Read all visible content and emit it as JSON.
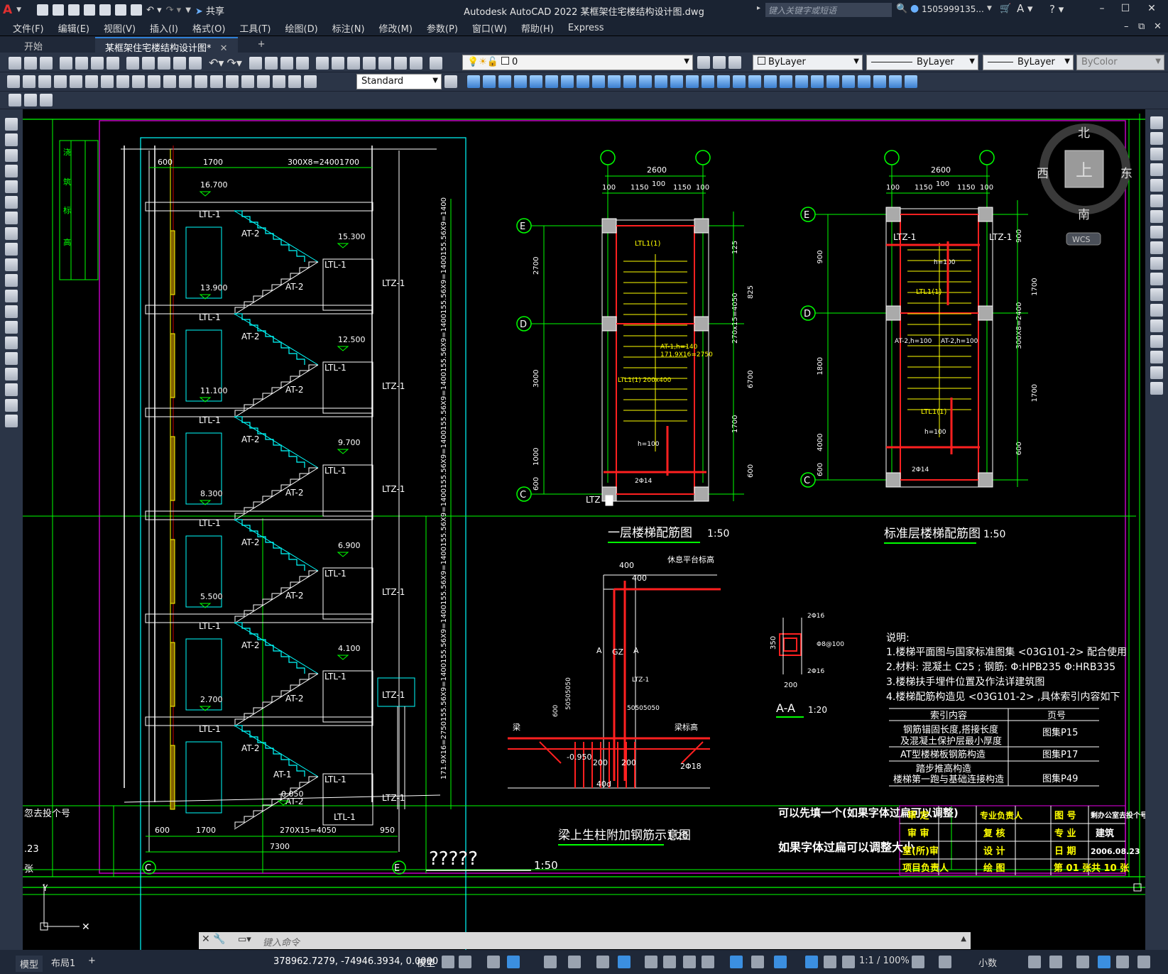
{
  "window": {
    "title": "Autodesk AutoCAD 2022   某框架住宅楼结构设计图.dwg",
    "share": "共享",
    "search_placeholder": "键入关键字或短语",
    "user": "1505999135...",
    "min": "–",
    "max": "☐",
    "close": "✕"
  },
  "menu": [
    "文件(F)",
    "编辑(E)",
    "视图(V)",
    "插入(I)",
    "格式(O)",
    "工具(T)",
    "绘图(D)",
    "标注(N)",
    "修改(M)",
    "参数(P)",
    "窗口(W)",
    "帮助(H)",
    "Express"
  ],
  "tabs": {
    "start": "开始",
    "doc": "某框架住宅楼结构设计图*",
    "close": "✕",
    "add": "+"
  },
  "toolbar": {
    "layer": "0",
    "dimstyle": "Standard",
    "color": "ByLayer",
    "linetype": "ByLayer",
    "lineweight": "ByLayer",
    "plotstyle": "ByColor"
  },
  "viewcube": {
    "north": "北",
    "south": "南",
    "east": "东",
    "west": "西",
    "top": "上",
    "wcs": "WCS"
  },
  "command": {
    "placeholder": "键入命令"
  },
  "status": {
    "model_tab": "模型",
    "layout_tab": "布局1",
    "add": "+",
    "coords": "378962.7279, -74946.3934, 0.0000",
    "model": "模型",
    "scale": "1:1 / 100%",
    "units": "小数"
  },
  "drawing": {
    "section": {
      "top_dims": [
        "600",
        "1700",
        "300X8=2400",
        "1700"
      ],
      "bottom_dims": [
        "600",
        "1700",
        "270X15=4050",
        "950"
      ],
      "total": "7300",
      "elevations": [
        "16.700",
        "15.300",
        "13.900",
        "12.500",
        "11.100",
        "9.700",
        "8.300",
        "6.900",
        "5.500",
        "4.100",
        "2.700",
        "-0.050"
      ],
      "side_dims": [
        "155.56X9=1400",
        "155.56X9=1400",
        "155.56X9=1400",
        "155.56X9=1400",
        "155.56X9=1400",
        "155.56X9=1400",
        "155.56X9=1400",
        "155.56X9=1400",
        "155.56X9=1400",
        "171.9X16=2750"
      ],
      "labels": {
        "ltl1": "LTL-1",
        "at2": "AT-2",
        "at1": "AT-1",
        "ltz1": "LTZ-1"
      },
      "axes": {
        "c": "C",
        "e": "E"
      },
      "title": "?????",
      "scale": "1:50",
      "left_labels": [
        "浇",
        "筑",
        "标",
        "高"
      ]
    },
    "plan1": {
      "title": "一层楼梯配筋图",
      "scale": "1:50",
      "dims_top": [
        "2600",
        "100",
        "1150",
        "100",
        "1150",
        "100"
      ],
      "dims_left": [
        "2700",
        "3000",
        "1000",
        "600"
      ],
      "dims_right": [
        "125",
        "825",
        "270x15=4050",
        "6700",
        "1700",
        "600"
      ],
      "axes": [
        "E",
        "D",
        "C"
      ],
      "ltz": "LTZ",
      "notes": [
        "LTL1(1)",
        "AT-1,h=140",
        "171.9X16=2750",
        "LTL1(1) 200x400",
        "h=100",
        "2Φ14"
      ]
    },
    "plan2": {
      "title": "标准层楼梯配筋图",
      "scale": "1:50",
      "dims_top": [
        "2600",
        "100",
        "1150",
        "100",
        "1150",
        "100"
      ],
      "dims_left": [
        "900",
        "1800",
        "4000",
        "600"
      ],
      "dims_right": [
        "900",
        "1700",
        "300X8=2400",
        "1700",
        "600"
      ],
      "axes": [
        "E",
        "D",
        "C"
      ],
      "labels": [
        "LTZ-1",
        "LTZ-1",
        "LTL1(1)",
        "LTL1(1)",
        "AT-2,h=100",
        "AT-2,h=100",
        "h=100",
        "h=100",
        "2Φ14"
      ]
    },
    "detail": {
      "title": "梁上生柱附加钢筋示意图",
      "scale": "1:20",
      "labels": [
        "休息平台标高",
        "400",
        "400",
        "A",
        "GZ",
        "A",
        "LTZ-1",
        "600",
        "50505050",
        "50505050",
        "梁",
        "梁标高",
        "-0.950",
        "200",
        "200",
        "40d",
        "2Φ18"
      ]
    },
    "aa": {
      "title": "A-A",
      "scale": "1:20",
      "labels": [
        "2Φ16",
        "Φ8@100",
        "350",
        "2Φ16",
        "200"
      ]
    },
    "notes": {
      "heading": "说明:",
      "lines": [
        "1.楼梯平面图与国家标准图集 <03G101-2> 配合使用",
        "2.材料: 混凝土 C25 ; 钢筋: Φ:HPB235  Φ:HRB335",
        "3.楼梯扶手埋件位置及作法详建筑图",
        "4.楼梯配筋构造见 <03G101-2> ,具体索引内容如下"
      ],
      "table_head": [
        "索引内容",
        "页号"
      ],
      "table_rows": [
        [
          "钢筋锚固长度,搭接长度\n及混凝土保护层最小厚度",
          "图集P15"
        ],
        [
          "AT型楼梯板钢筋构造",
          "图集P17"
        ],
        [
          "踏步推高构造\n楼梯第一跑与基础连接构造",
          "图集P49"
        ]
      ]
    },
    "titleblock": {
      "big1": "可以先填一个(如果字体过扁可以调整)",
      "big2": "如果字体过扁可以调整大小",
      "cells": [
        "审 定",
        "专业负责人",
        "图 号",
        "剩办公室去投个号",
        "审 审",
        "复 核",
        "专 业",
        "建筑",
        "室(所)审",
        "设 计",
        "日 期",
        "2006.08.23",
        "项目负责人",
        "绘 图",
        "第 01 张",
        "共 10 张"
      ],
      "left_cut": [
        "忽去投个号",
        ".23",
        "张"
      ]
    }
  }
}
